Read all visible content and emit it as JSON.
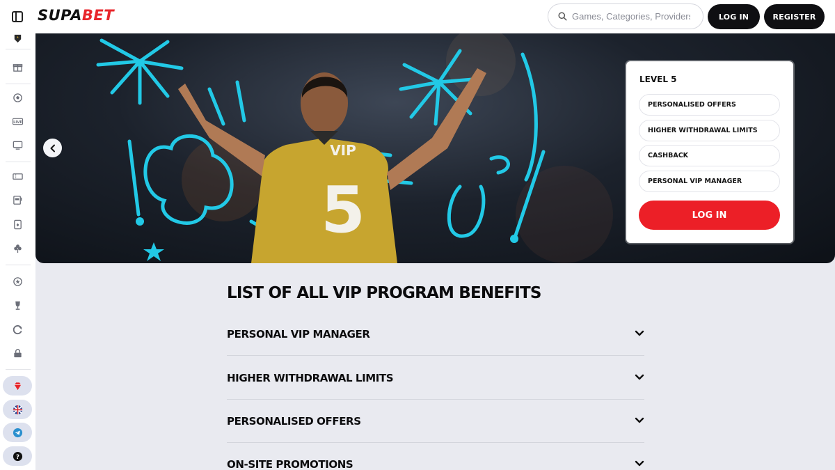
{
  "header": {
    "logo_main": "SUPA",
    "logo_accent": "BET",
    "search_placeholder": "Games, Categories, Providers",
    "login_label": "LOG IN",
    "register_label": "REGISTER"
  },
  "sidebar": {
    "icons": [
      "rank-badge-icon",
      "gift-icon",
      "soccer-ball-icon",
      "live-icon",
      "monitor-icon",
      "ticket-icon",
      "slot-machine-icon",
      "playing-card-icon",
      "clover-icon",
      "vip-badge-icon",
      "trophy-icon",
      "cashback-icon",
      "lock-icon"
    ],
    "pills": [
      "diamond-icon",
      "uk-flag-icon",
      "telegram-icon",
      "help-icon"
    ],
    "live_text": "LIVE"
  },
  "hero": {
    "jersey_label": "VIP",
    "jersey_number": "5",
    "card": {
      "level": "LEVEL 5",
      "benefits": [
        "PERSONALISED OFFERS",
        "HIGHER WITHDRAWAL LIMITS",
        "CASHBACK",
        "PERSONAL VIP MANAGER"
      ],
      "login_label": "LOG IN"
    }
  },
  "benefits_section": {
    "title": "LIST OF ALL VIP PROGRAM BENEFITS",
    "items": [
      "PERSONAL VIP MANAGER",
      "HIGHER WITHDRAWAL LIMITS",
      "PERSONALISED OFFERS",
      "ON-SITE PROMOTIONS"
    ]
  },
  "colors": {
    "brand_red": "#e8262b",
    "dark_button": "#0f0f12",
    "doodle_cyan": "#22c9e6",
    "jersey_gold": "#c7a52f",
    "page_bg": "#e9eaf0"
  }
}
